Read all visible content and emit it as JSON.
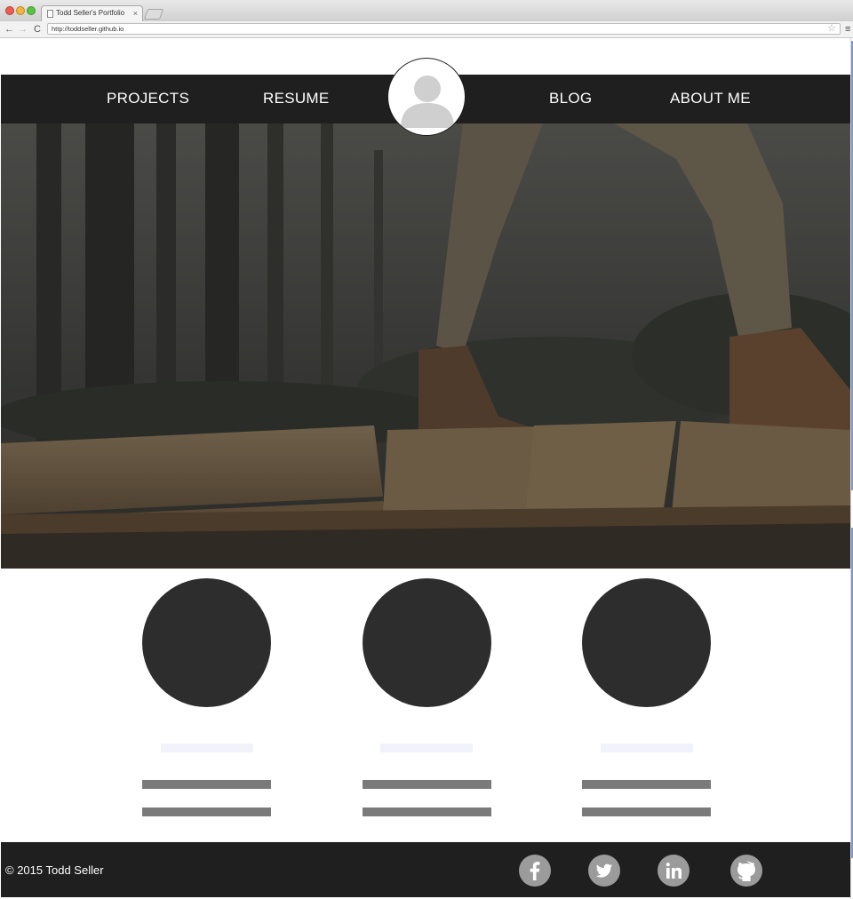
{
  "browser": {
    "tab_title": "Todd Seller's Portfolio",
    "tab_close": "×",
    "url": "http://toddseller.github.io",
    "back_glyph": "←",
    "forward_glyph": "→",
    "reload_glyph": "C",
    "star_glyph": "☆",
    "menu_glyph": "≡"
  },
  "nav": {
    "items": [
      {
        "label": "PROJECTS"
      },
      {
        "label": "RESUME"
      },
      {
        "label": "BLOG"
      },
      {
        "label": "ABOUT ME"
      }
    ],
    "avatar_icon": "default-user-silhouette"
  },
  "hero": {
    "image": "hiker-walking-on-wooden-boardwalk-in-forest"
  },
  "features": {
    "count": 3,
    "circle_color": "#2d2d2d"
  },
  "footer": {
    "copyright": "© 2015 Todd Seller",
    "social": [
      {
        "icon": "facebook-icon"
      },
      {
        "icon": "twitter-icon"
      },
      {
        "icon": "linkedin-icon"
      },
      {
        "icon": "github-icon"
      }
    ]
  },
  "colors": {
    "navbar": "#1f1f1f",
    "footer": "#1f1f1f",
    "social_icon_bg": "#9b9b9b",
    "placeholder_line": "#7a7a7a"
  }
}
